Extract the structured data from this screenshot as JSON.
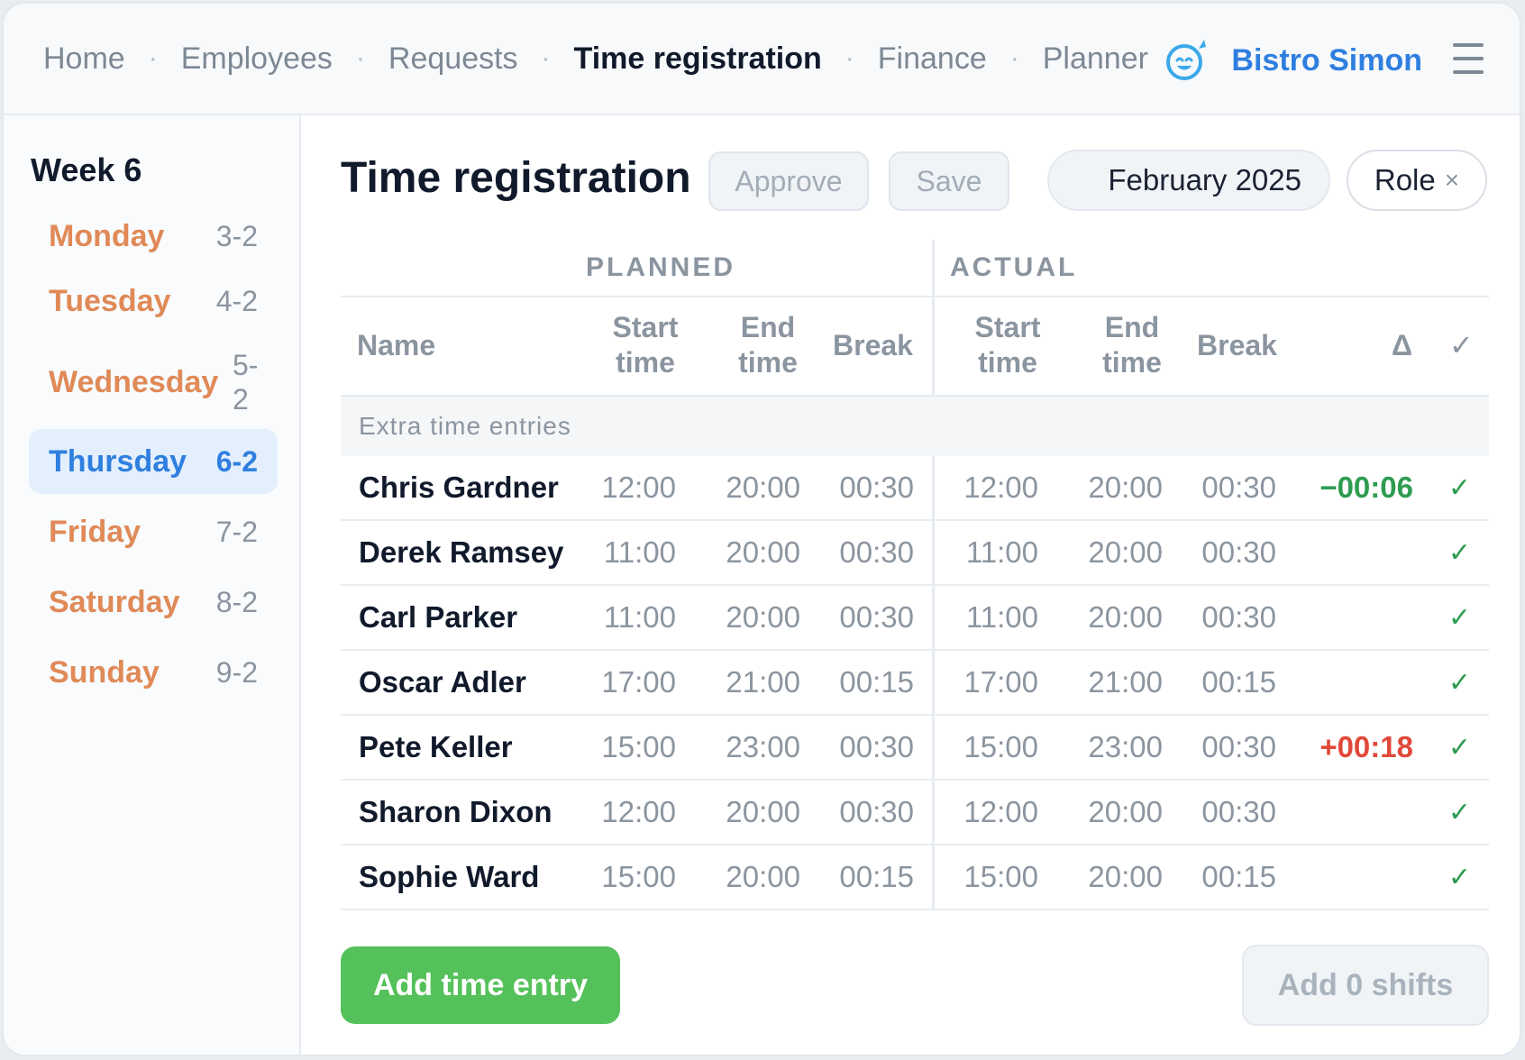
{
  "nav": {
    "items": [
      {
        "label": "Home",
        "active": false
      },
      {
        "label": "Employees",
        "active": false
      },
      {
        "label": "Requests",
        "active": false
      },
      {
        "label": "Time registration",
        "active": true
      },
      {
        "label": "Finance",
        "active": false
      },
      {
        "label": "Planner",
        "active": false
      }
    ],
    "brand_name": "Bistro Simon",
    "logo_icon": "smiley-face-logo-icon",
    "menu_icon": "hamburger-menu-icon"
  },
  "sidebar": {
    "week_title": "Week 6",
    "days": [
      {
        "name": "Monday",
        "date": "3-2",
        "active": false
      },
      {
        "name": "Tuesday",
        "date": "4-2",
        "active": false
      },
      {
        "name": "Wednesday",
        "date": "5-2",
        "active": false
      },
      {
        "name": "Thursday",
        "date": "6-2",
        "active": true
      },
      {
        "name": "Friday",
        "date": "7-2",
        "active": false
      },
      {
        "name": "Saturday",
        "date": "8-2",
        "active": false
      },
      {
        "name": "Sunday",
        "date": "9-2",
        "active": false
      }
    ]
  },
  "main": {
    "title": "Time registration",
    "approve_label": "Approve",
    "save_label": "Save",
    "month_label": "February 2025",
    "role_filter_label": "Role",
    "role_clear_glyph": "×",
    "add_entry_label": "Add time entry",
    "add_shifts_label": "Add 0 shifts"
  },
  "table": {
    "group_planned": "PLANNED",
    "group_actual": "ACTUAL",
    "headers": {
      "name": "Name",
      "start_a": "Start",
      "start_b": "time",
      "end_a": "End",
      "end_b": "time",
      "break": "Break",
      "delta": "Δ",
      "check": "✓"
    },
    "extra_label": "Extra time entries",
    "rows": [
      {
        "name": "Chris Gardner",
        "p_start": "12:00",
        "p_end": "20:00",
        "p_break": "00:30",
        "a_start": "12:00",
        "a_end": "20:00",
        "a_break": "00:30",
        "delta": "−00:06",
        "delta_sign": "neg",
        "check": "✓"
      },
      {
        "name": "Derek Ramsey",
        "p_start": "11:00",
        "p_end": "20:00",
        "p_break": "00:30",
        "a_start": "11:00",
        "a_end": "20:00",
        "a_break": "00:30",
        "delta": "",
        "delta_sign": "",
        "check": "✓"
      },
      {
        "name": "Carl Parker",
        "p_start": "11:00",
        "p_end": "20:00",
        "p_break": "00:30",
        "a_start": "11:00",
        "a_end": "20:00",
        "a_break": "00:30",
        "delta": "",
        "delta_sign": "",
        "check": "✓"
      },
      {
        "name": "Oscar Adler",
        "p_start": "17:00",
        "p_end": "21:00",
        "p_break": "00:15",
        "a_start": "17:00",
        "a_end": "21:00",
        "a_break": "00:15",
        "delta": "",
        "delta_sign": "",
        "check": "✓"
      },
      {
        "name": "Pete Keller",
        "p_start": "15:00",
        "p_end": "23:00",
        "p_break": "00:30",
        "a_start": "15:00",
        "a_end": "23:00",
        "a_break": "00:30",
        "delta": "+00:18",
        "delta_sign": "pos",
        "check": "✓"
      },
      {
        "name": "Sharon Dixon",
        "p_start": "12:00",
        "p_end": "20:00",
        "p_break": "00:30",
        "a_start": "12:00",
        "a_end": "20:00",
        "a_break": "00:30",
        "delta": "",
        "delta_sign": "",
        "check": "✓"
      },
      {
        "name": "Sophie Ward",
        "p_start": "15:00",
        "p_end": "20:00",
        "p_break": "00:15",
        "a_start": "15:00",
        "a_end": "20:00",
        "a_break": "00:15",
        "delta": "",
        "delta_sign": "",
        "check": "✓"
      }
    ]
  }
}
